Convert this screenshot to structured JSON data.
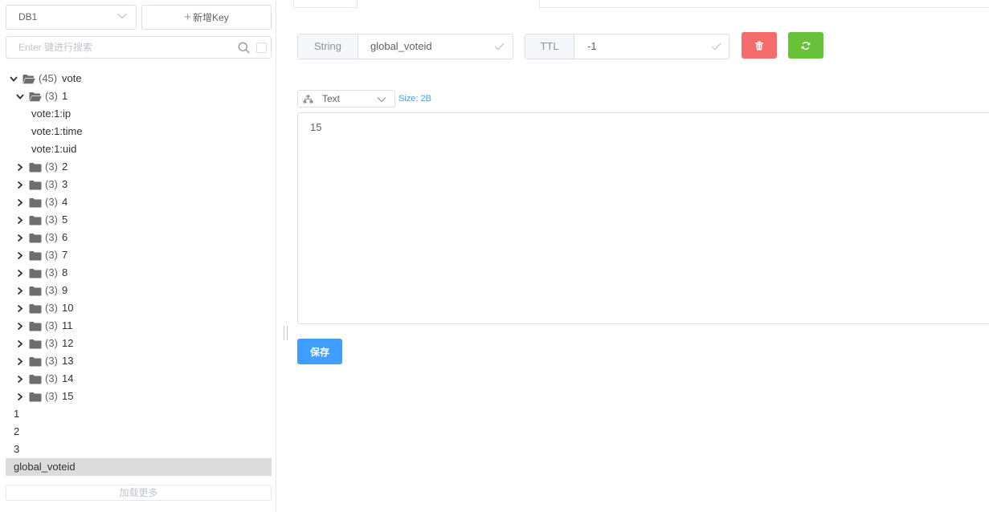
{
  "sidebar": {
    "db_select": {
      "value": "DB1"
    },
    "new_key_label": "新增Key",
    "search": {
      "placeholder": "Enter 键进行搜索"
    },
    "load_more_label": "加载更多",
    "tree": [
      {
        "level": 0,
        "type": "folder",
        "expanded": true,
        "count": "(45)",
        "name": "vote"
      },
      {
        "level": 1,
        "type": "folder",
        "expanded": true,
        "count": "(3)",
        "name": "1"
      },
      {
        "level": 2,
        "type": "key",
        "name": "vote:1:ip"
      },
      {
        "level": 2,
        "type": "key",
        "name": "vote:1:time"
      },
      {
        "level": 2,
        "type": "key",
        "name": "vote:1:uid"
      },
      {
        "level": 1,
        "type": "folder",
        "expanded": false,
        "count": "(3)",
        "name": "2"
      },
      {
        "level": 1,
        "type": "folder",
        "expanded": false,
        "count": "(3)",
        "name": "3"
      },
      {
        "level": 1,
        "type": "folder",
        "expanded": false,
        "count": "(3)",
        "name": "4"
      },
      {
        "level": 1,
        "type": "folder",
        "expanded": false,
        "count": "(3)",
        "name": "5"
      },
      {
        "level": 1,
        "type": "folder",
        "expanded": false,
        "count": "(3)",
        "name": "6"
      },
      {
        "level": 1,
        "type": "folder",
        "expanded": false,
        "count": "(3)",
        "name": "7"
      },
      {
        "level": 1,
        "type": "folder",
        "expanded": false,
        "count": "(3)",
        "name": "8"
      },
      {
        "level": 1,
        "type": "folder",
        "expanded": false,
        "count": "(3)",
        "name": "9"
      },
      {
        "level": 1,
        "type": "folder",
        "expanded": false,
        "count": "(3)",
        "name": "10"
      },
      {
        "level": 1,
        "type": "folder",
        "expanded": false,
        "count": "(3)",
        "name": "11"
      },
      {
        "level": 1,
        "type": "folder",
        "expanded": false,
        "count": "(3)",
        "name": "12"
      },
      {
        "level": 1,
        "type": "folder",
        "expanded": false,
        "count": "(3)",
        "name": "13"
      },
      {
        "level": 1,
        "type": "folder",
        "expanded": false,
        "count": "(3)",
        "name": "14"
      },
      {
        "level": 1,
        "type": "folder",
        "expanded": false,
        "count": "(3)",
        "name": "15"
      },
      {
        "level": 0,
        "type": "key",
        "name": "1"
      },
      {
        "level": 0,
        "type": "key",
        "name": "2"
      },
      {
        "level": 0,
        "type": "key",
        "name": "3"
      },
      {
        "level": 0,
        "type": "key",
        "name": "global_voteid",
        "selected": true
      }
    ]
  },
  "key_header": {
    "type_label": "String",
    "key_name": "global_voteid",
    "ttl_label": "TTL",
    "ttl_value": "-1"
  },
  "viewer": {
    "format": "Text",
    "size": "Size: 2B",
    "value": "15"
  },
  "save_label": "保存",
  "icons": {
    "delete": "trash-icon",
    "refresh": "refresh-icon",
    "folder": "folder-icon",
    "search": "search-icon"
  },
  "colors": {
    "danger": "#f56c6c",
    "success": "#67c23a",
    "primary": "#409eff",
    "selected_row": "#dcdcdc",
    "folder": "#6e6e6e"
  }
}
